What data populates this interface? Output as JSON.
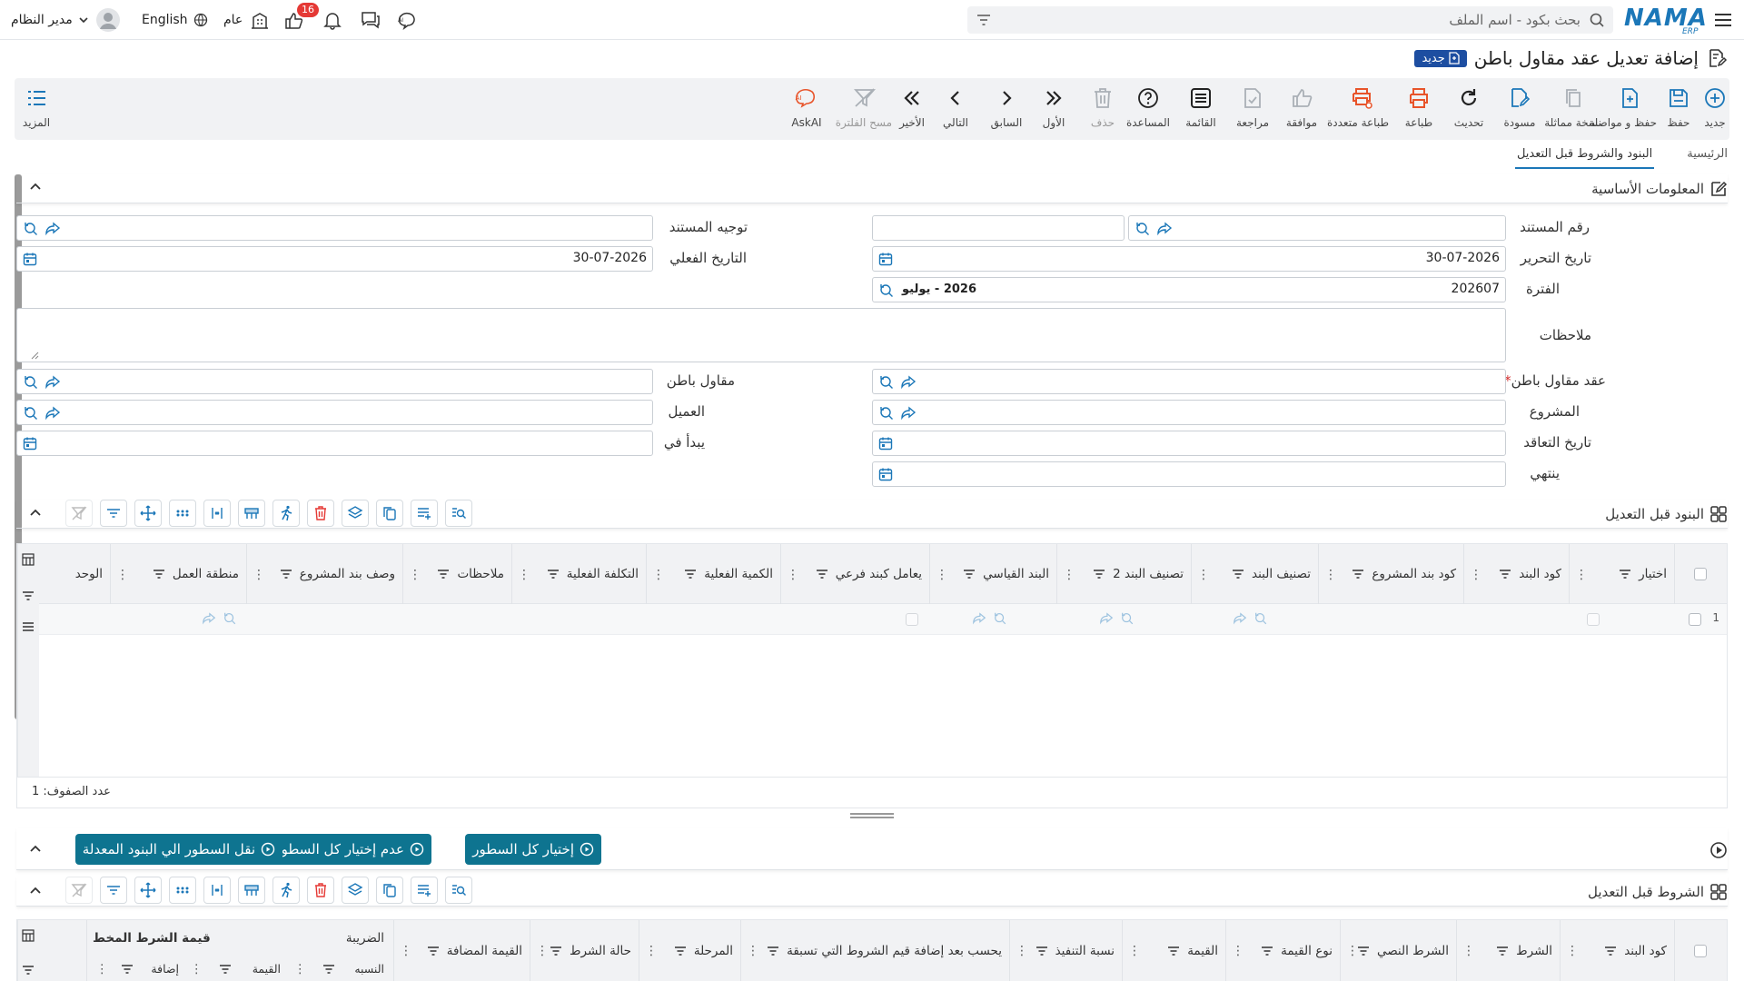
{
  "topbar": {
    "logo": "NAMA",
    "logo_sub": "ERP",
    "search_placeholder": "بحث بكود - اسم الملف",
    "user_name": "مدير النظام",
    "language": "English",
    "public_label": "عام",
    "notification_count": "16"
  },
  "page": {
    "title": "إضافة تعديل عقد مقاول باطن",
    "status_badge": "جديد"
  },
  "toolbar": {
    "buttons": [
      {
        "label": "جديد",
        "icon": "plus-circle-icon"
      },
      {
        "label": "حفظ",
        "icon": "save-icon"
      },
      {
        "label": "حفظ و مواصلة",
        "icon": "save-continue-icon"
      },
      {
        "label": "نسخة مماثلة",
        "icon": "copy-icon"
      },
      {
        "label": "مسودة",
        "icon": "draft-icon"
      },
      {
        "label": "تحديث",
        "icon": "refresh-icon"
      },
      {
        "label": "طباعة",
        "icon": "print-icon"
      },
      {
        "label": "طباعة متعددة",
        "icon": "multi-print-icon"
      },
      {
        "label": "موافقة",
        "icon": "thumbs-up-icon"
      },
      {
        "label": "مراجعة",
        "icon": "review-icon"
      },
      {
        "label": "القائمة",
        "icon": "list-icon"
      },
      {
        "label": "المساعدة",
        "icon": "help-icon"
      },
      {
        "label": "حذف",
        "icon": "trash-icon"
      },
      {
        "label": "الأول",
        "icon": "first-icon"
      },
      {
        "label": "السابق",
        "icon": "previous-icon"
      },
      {
        "label": "التالي",
        "icon": "next-icon"
      },
      {
        "label": "الأخير",
        "icon": "last-icon"
      },
      {
        "label": "مسح الفلترة",
        "icon": "clear-filter-icon"
      },
      {
        "label": "AskAI",
        "icon": "ai-icon"
      }
    ],
    "more_label": "المزيد"
  },
  "tabs": [
    "الرئيسية",
    "البنود والشروط قبل التعديل"
  ],
  "basic_info": {
    "title": "المعلومات الأساسية",
    "doc_number_label": "رقم المستند",
    "doc_direction_label": "توجيه المستند",
    "edit_date_label": "تاريخ التحرير",
    "edit_date_value": "30-07-2026",
    "actual_date_label": "التاريخ الفعلي",
    "actual_date_value": "30-07-2026",
    "period_label": "الفترة",
    "period_value": "202607",
    "period_name": "2026 - يوليو",
    "notes_label": "ملاحظات",
    "subcontract_label": "عقد مقاول باطن",
    "subcontractor_label": "مقاول باطن",
    "project_label": "المشروع",
    "customer_label": "العميل",
    "contract_date_label": "تاريخ التعاقد",
    "starts_label": "يبدأ في",
    "ends_label": "ينتهي"
  },
  "items_section": {
    "title": "البنود قبل التعديل",
    "columns": [
      "اختيار",
      "كود البند",
      "كود بند المشروع",
      "تصنيف البند",
      "تصنيف البند 2",
      "البند القياسي",
      "يعامل كبند فرعي",
      "الكمية الفعلية",
      "التكلفة الفعلية",
      "ملاحظات",
      "وصف بند المشروع",
      "منطقة العمل",
      "الوحد"
    ],
    "row_number": "1",
    "row_count_label": "عدد الصفوف:",
    "row_count": "1"
  },
  "actions": {
    "select_all": "إختيار كل السطور",
    "deselect_all": "عدم إختيار كل السطور",
    "move_lines": "نقل السطور الي البنود المعدلة"
  },
  "terms_section": {
    "title": "الشروط قبل التعديل",
    "columns": [
      "كود البند",
      "الشرط",
      "الشرط النصي",
      "نوع القيمة",
      "القيمة",
      "نسبة التنفيذ",
      "يحسب بعد إضافة قيم الشروط التي تسبقة",
      "المرحلة",
      "حالة الشرط",
      "القيمة المضافة"
    ],
    "tax_group": "الضريبة",
    "tax_cols": [
      "النسبه",
      "القيمة",
      "إضافة"
    ],
    "planned_value": "قيمة الشرط المخط"
  },
  "colors": {
    "accent": "#1b77b8",
    "action_button": "#0e7490",
    "badge": "#1d4ea1",
    "danger": "#e53935"
  }
}
